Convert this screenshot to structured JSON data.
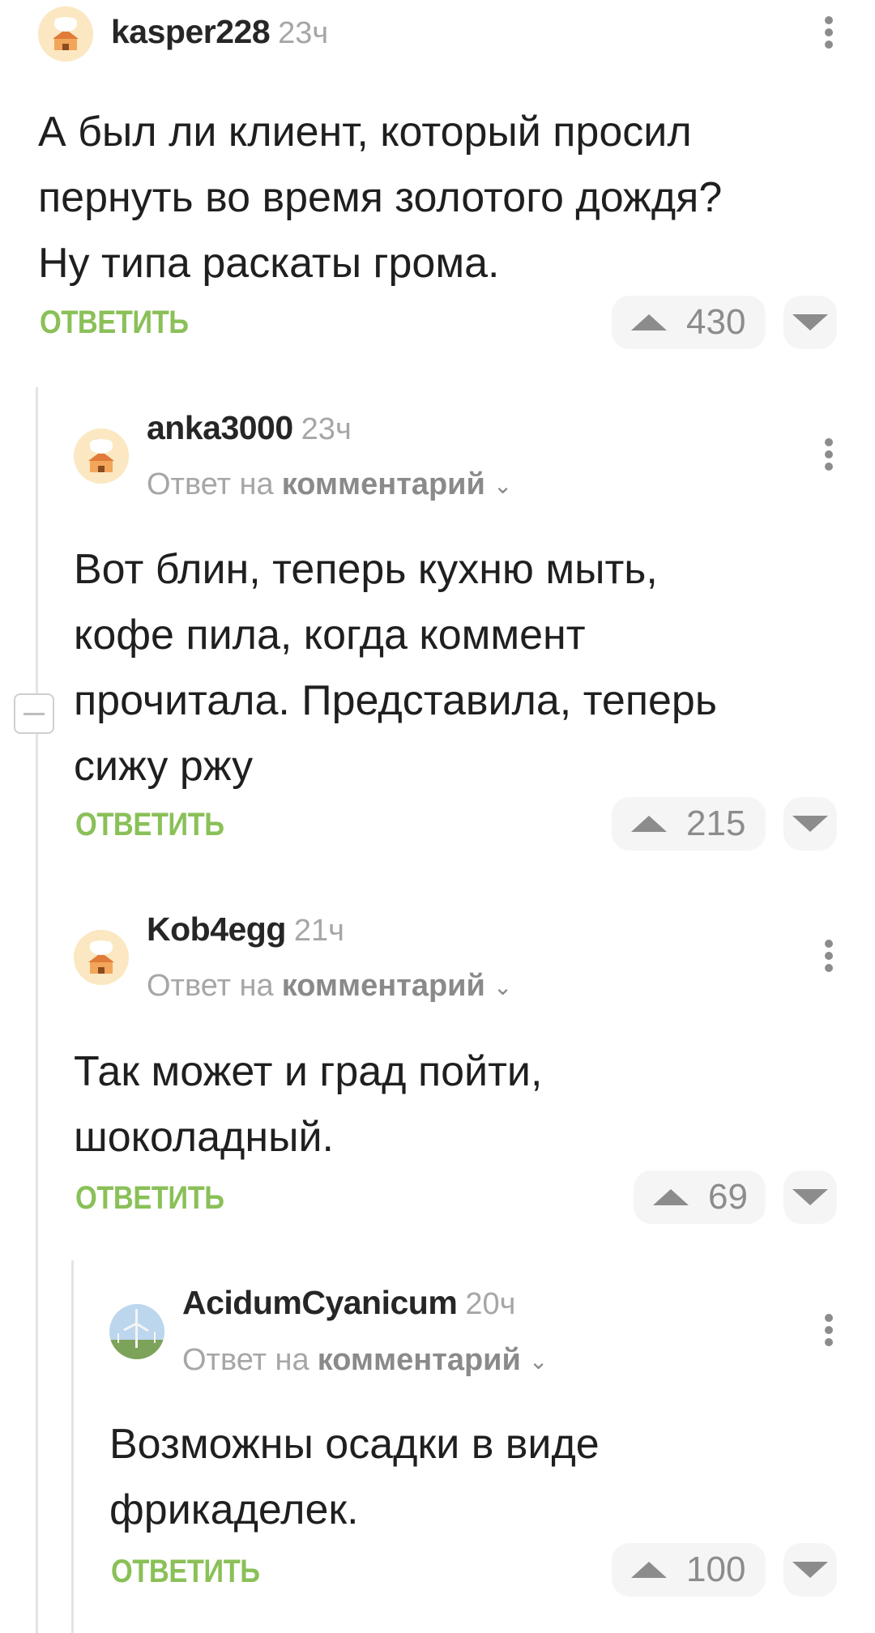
{
  "comments": [
    {
      "user": "kasper228",
      "time": "23ч",
      "lines": [
        "А был ли клиент, который просил",
        "пернуть во время золотого дождя?",
        "Ну типа раскаты грома."
      ],
      "reply_label": "ОТВЕТИТЬ",
      "votes": "430"
    },
    {
      "user": "anka3000",
      "time": "23ч",
      "reply_prefix": "Ответ на",
      "reply_target": "комментарий",
      "lines": [
        "Вот блин, теперь кухню мыть,",
        "кофе пила, когда коммент",
        "прочитала. Представила, теперь",
        "сижу ржу"
      ],
      "reply_label": "ОТВЕТИТЬ",
      "votes": "215"
    },
    {
      "user": "Kob4egg",
      "time": "21ч",
      "reply_prefix": "Ответ на",
      "reply_target": "комментарий",
      "lines": [
        "Так может и град пойти,",
        "шоколадный."
      ],
      "reply_label": "ОТВЕТИТЬ",
      "votes": "69"
    },
    {
      "user": "AcidumCyanicum",
      "time": "20ч",
      "reply_prefix": "Ответ на",
      "reply_target": "комментарий",
      "lines": [
        "Возможны осадки в виде",
        "фрикаделек."
      ],
      "reply_label": "ОТВЕТИТЬ",
      "votes": "100"
    }
  ],
  "icons": {
    "default_avatar": "chef-avatar-icon",
    "acidum_avatar": "wind-turbine-avatar",
    "more": "more-vertical-icon",
    "upvote": "upvote-arrow-icon",
    "downvote": "downvote-arrow-icon",
    "collapse": "collapse-thread-icon",
    "chevron": "chevron-down-icon"
  },
  "colors": {
    "reply_green": "#8ac058",
    "muted_text": "#a6a6a6",
    "pill_bg": "#f5f5f5"
  }
}
